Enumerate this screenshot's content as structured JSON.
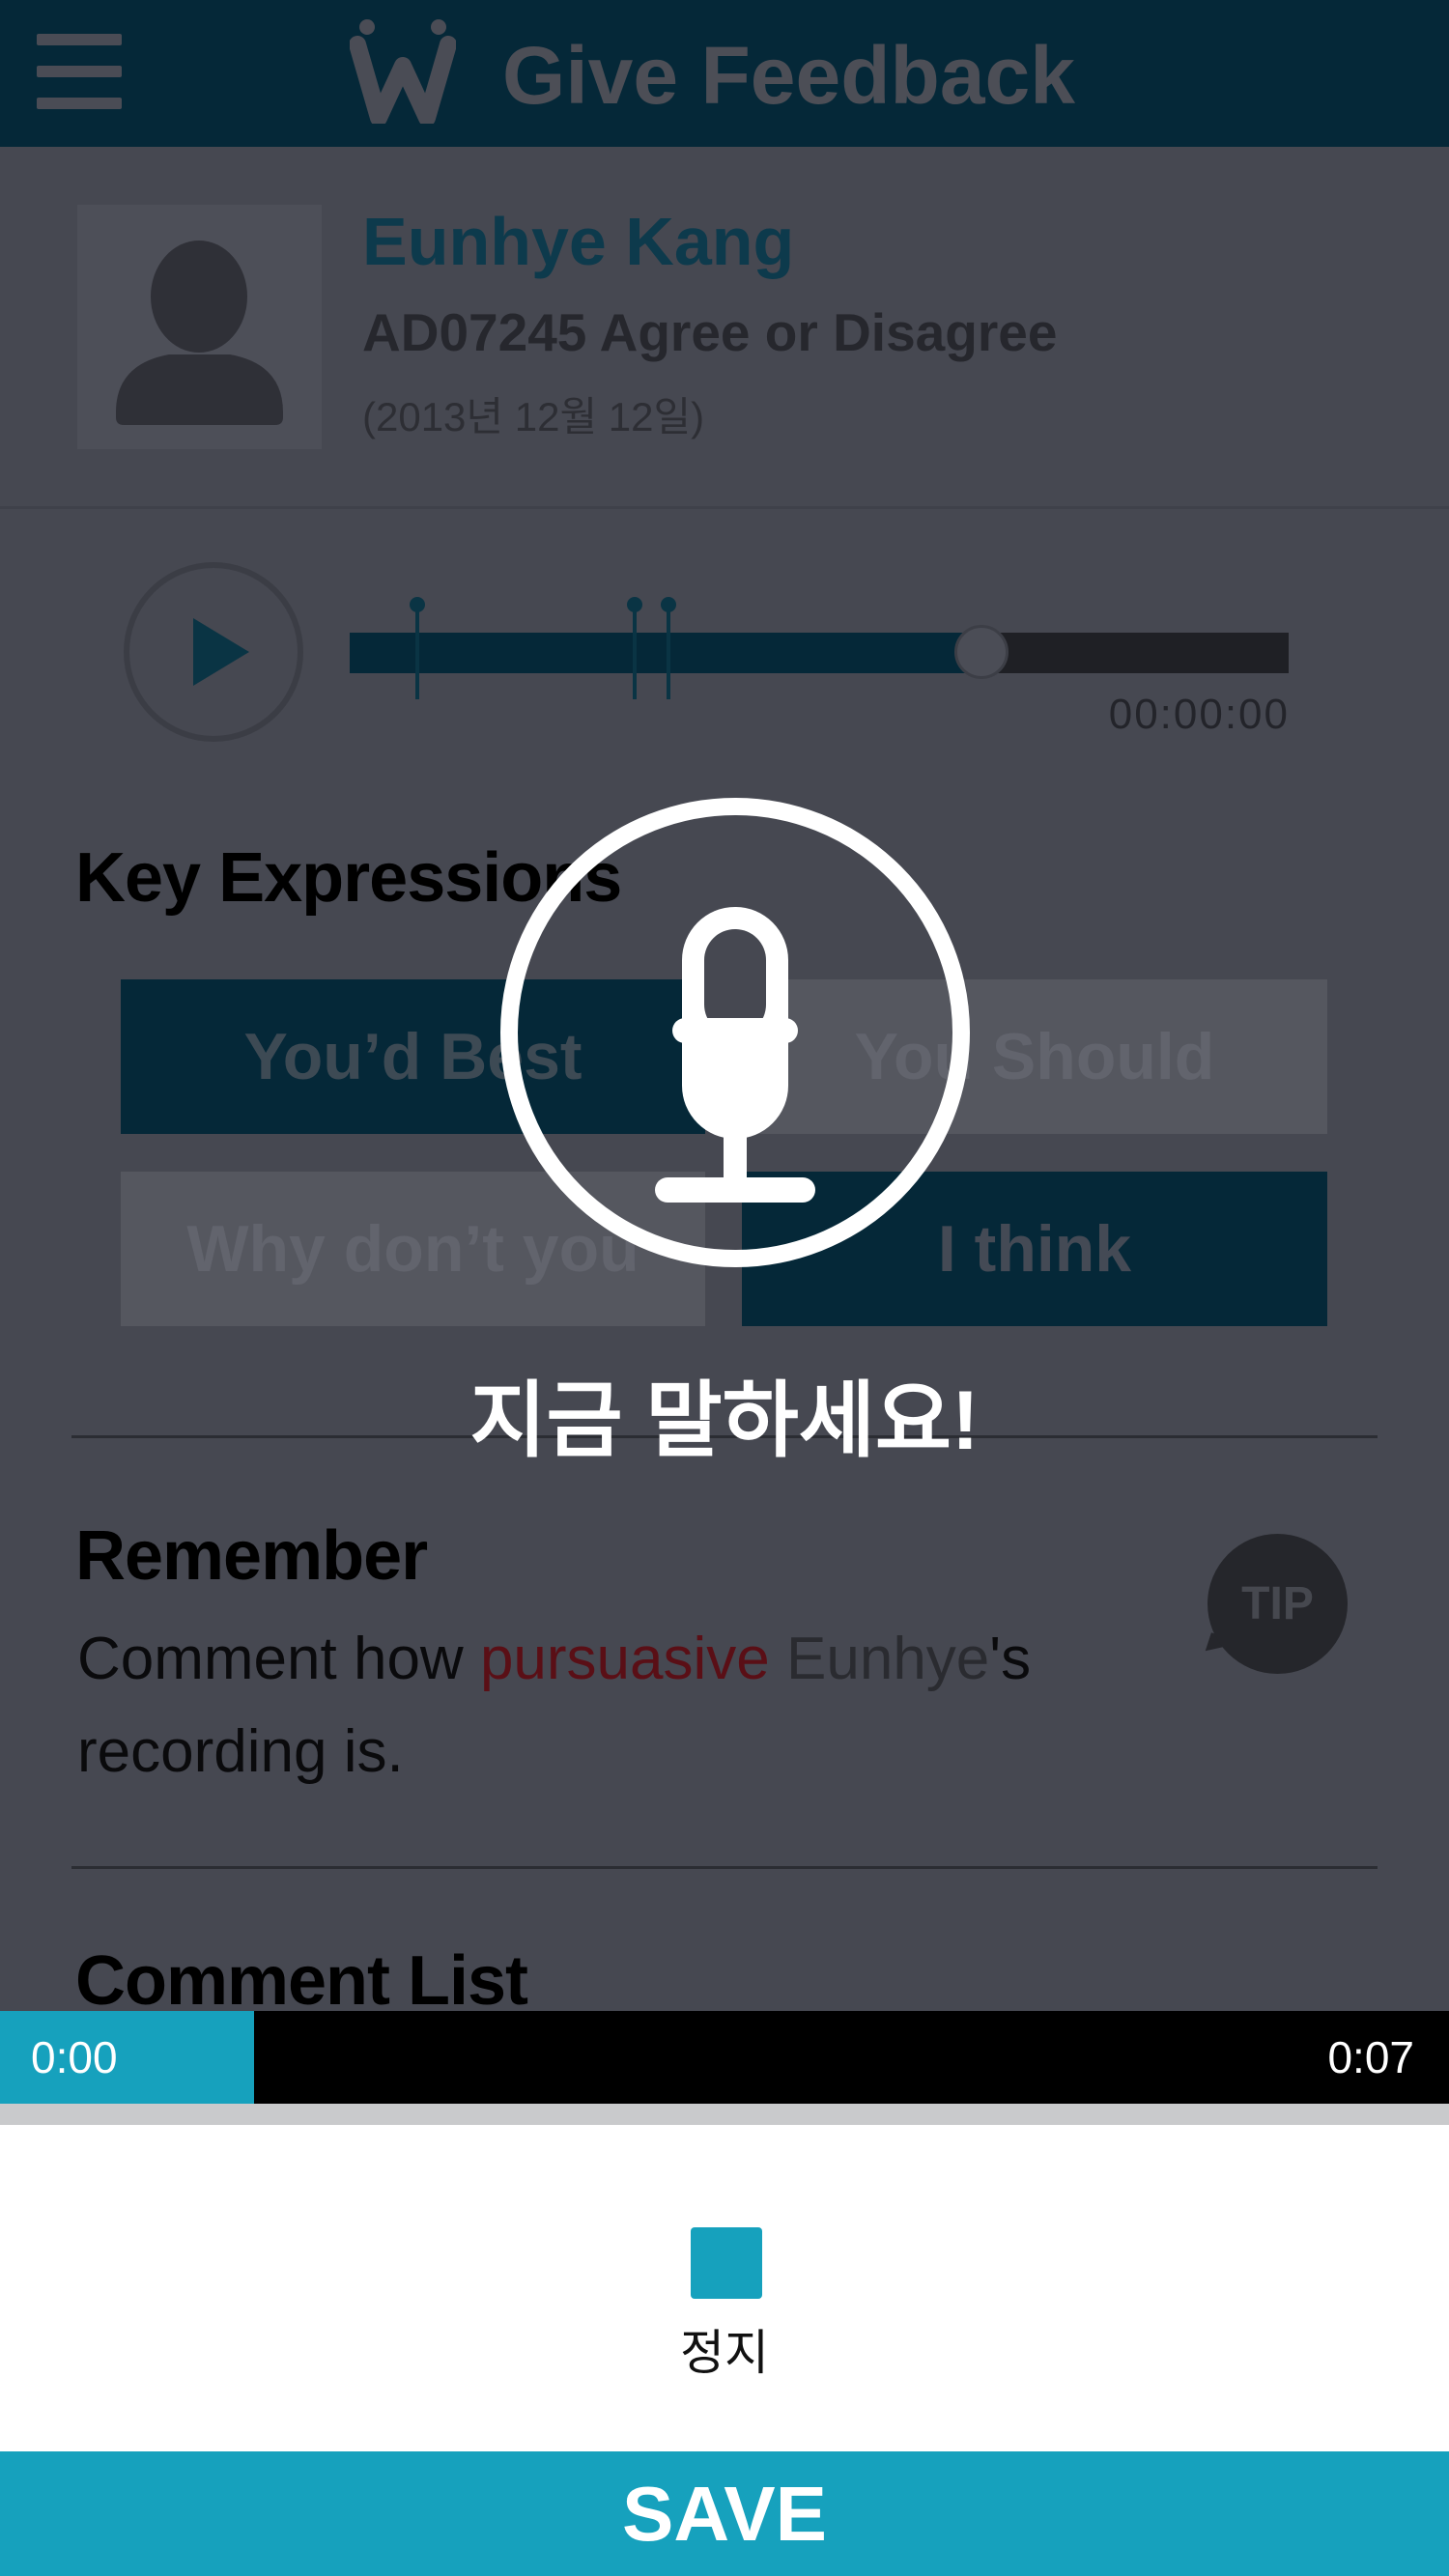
{
  "header": {
    "title": "Give Feedback",
    "logo": "W"
  },
  "profile": {
    "name": "Eunhye Kang",
    "subtitle": "AD07245  Agree or Disagree",
    "date": "(2013년 12월 12일)"
  },
  "player": {
    "time": "00:00:00",
    "progress_fraction": 0.67
  },
  "key_expressions": {
    "title": "Key Expressions",
    "items": [
      "You’d Best",
      "You Should",
      "Why don’t you",
      "I think"
    ]
  },
  "remember": {
    "title": "Remember",
    "text_before": "Comment how ",
    "highlight_word": "pursuasive",
    "space": " ",
    "name_word": "Eunhye",
    "text_after": "'s recording is.",
    "tip_label": "TIP"
  },
  "comment_list": {
    "title": "Comment List"
  },
  "recording": {
    "prompt": "지금 말하세요!",
    "elapsed": "0:00",
    "limit": "0:07",
    "progress_fraction": 0.175
  },
  "controls": {
    "stop_label": "정지",
    "save_label": "SAVE"
  },
  "colors": {
    "accent": "#16a1bd",
    "header_bg": "#052838",
    "overlay_bg": "#464851",
    "highlight_red": "#5a0f16"
  }
}
